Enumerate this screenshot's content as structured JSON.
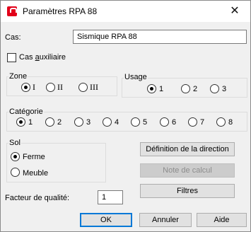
{
  "window": {
    "title": "Paramètres RPA 88",
    "close_glyph": "✕",
    "app_icon": "robot-app-icon"
  },
  "cas": {
    "label": "Cas:",
    "value": "Sismique RPA 88"
  },
  "cas_auxiliaire": {
    "label_pre": "Cas ",
    "label_accel": "a",
    "label_post": "uxiliaire",
    "checked": false
  },
  "zone": {
    "label": "Zone",
    "options": [
      "I",
      "II",
      "III"
    ],
    "selected": "I"
  },
  "usage": {
    "label": "Usage",
    "options": [
      "1",
      "2",
      "3"
    ],
    "selected": "1"
  },
  "categorie": {
    "label": "Catégorie",
    "options": [
      "1",
      "2",
      "3",
      "4",
      "5",
      "6",
      "7",
      "8"
    ],
    "selected": "1"
  },
  "sol": {
    "label": "Sol",
    "options": [
      "Ferme",
      "Meuble"
    ],
    "selected": "Ferme"
  },
  "buttons": {
    "definition": "Définition de la direction",
    "note": "Note de calcul",
    "filtres": "Filtres",
    "ok": "OK",
    "annuler": "Annuler",
    "aide": "Aide"
  },
  "facteur": {
    "label": "Facteur de qualité:",
    "value": "1"
  },
  "colors": {
    "accent": "#0078d7",
    "icon_red": "#e2001a",
    "disabled_text": "#8d8d8d"
  }
}
